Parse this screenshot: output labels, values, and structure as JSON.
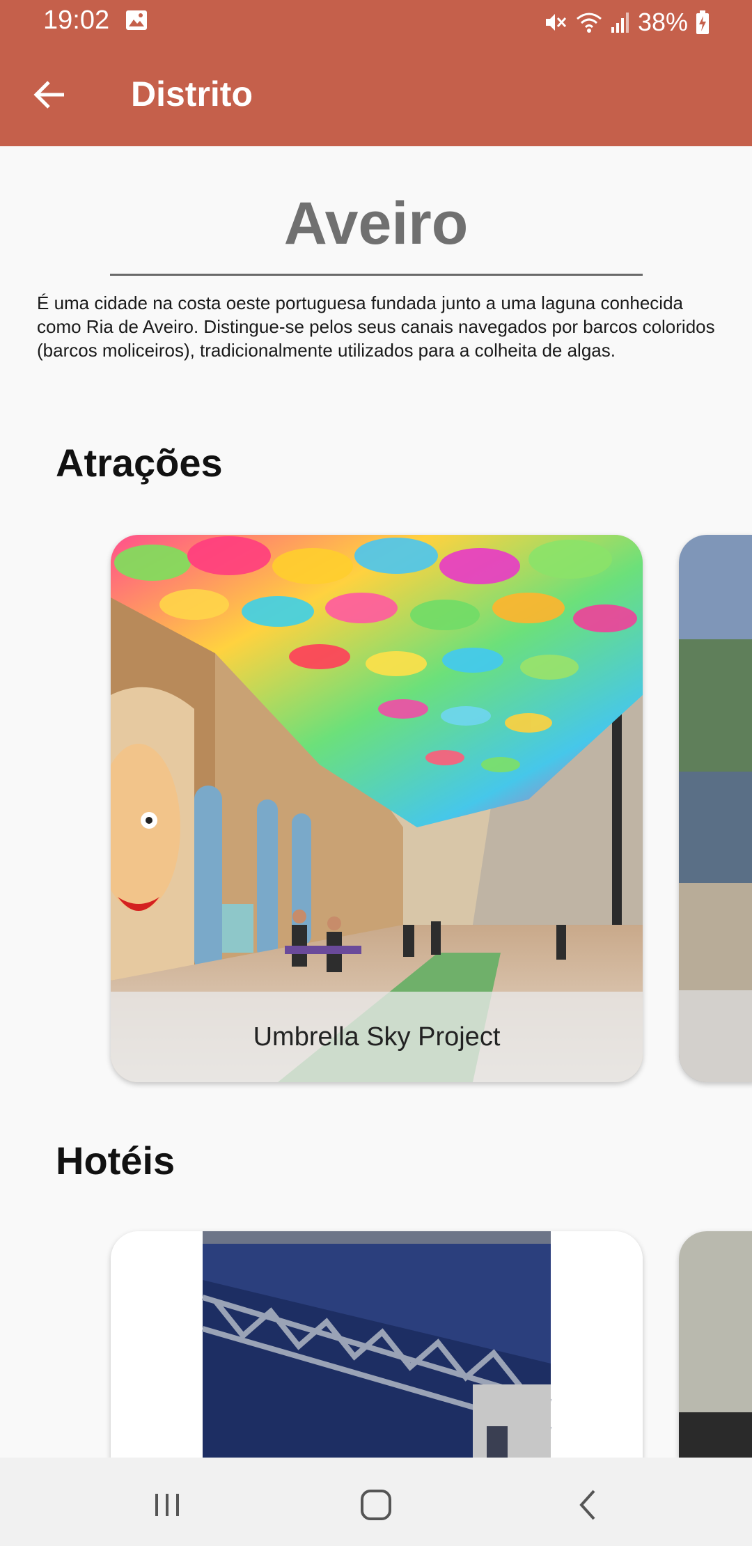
{
  "status_bar": {
    "time": "19:02",
    "battery": "38%"
  },
  "app_bar": {
    "title": "Distrito"
  },
  "district": {
    "name": "Aveiro",
    "description": "É uma cidade na costa oeste portuguesa fundada junto a uma laguna conhecida como Ria de Aveiro. Distingue-se pelos seus canais navegados por barcos coloridos (barcos moliceiros), tradicionalmente utilizados para a colheita de algas."
  },
  "attractions": {
    "title": "Atrações",
    "items": [
      {
        "name": "Umbrella Sky Project"
      }
    ]
  },
  "hotels": {
    "title": "Hotéis"
  },
  "colors": {
    "primary": "#c5604b",
    "background": "#f9f9f9"
  }
}
